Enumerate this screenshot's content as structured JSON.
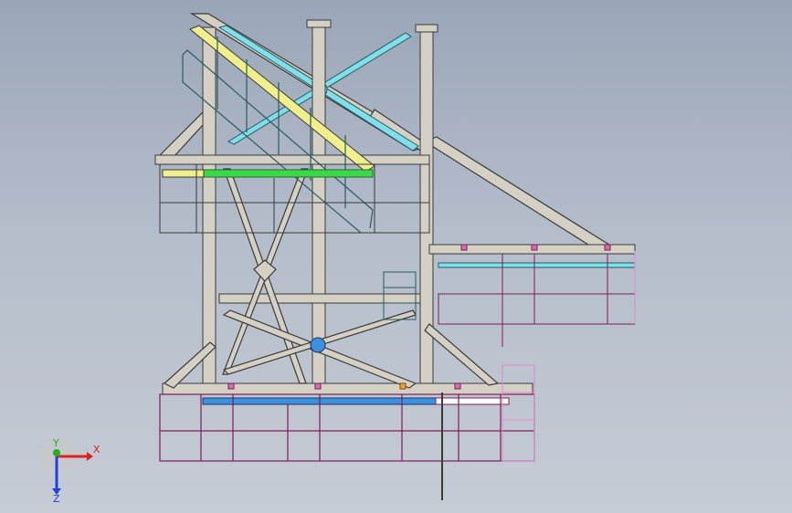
{
  "viewport": {
    "name": "structure-elevation-view",
    "background_top": "#9aa6b8",
    "background_bottom": "#c6ccd6"
  },
  "colors": {
    "frame": "#d4d0c4",
    "frame_stroke": "#3a3a3a",
    "yellow_member": "#f0ef8c",
    "cyan_member": "#7fe0ec",
    "green_member": "#39d94a",
    "blue_member": "#3d8fe0",
    "platform": "#7a1f5a",
    "rail_pink": "#e08ad0",
    "handrail": "#3a3a3a"
  },
  "triad": {
    "x_label": "X",
    "y_label": "Y",
    "z_label": "Z",
    "x_color": "#e02020",
    "y_color": "#20b020",
    "z_color": "#2040e0"
  }
}
